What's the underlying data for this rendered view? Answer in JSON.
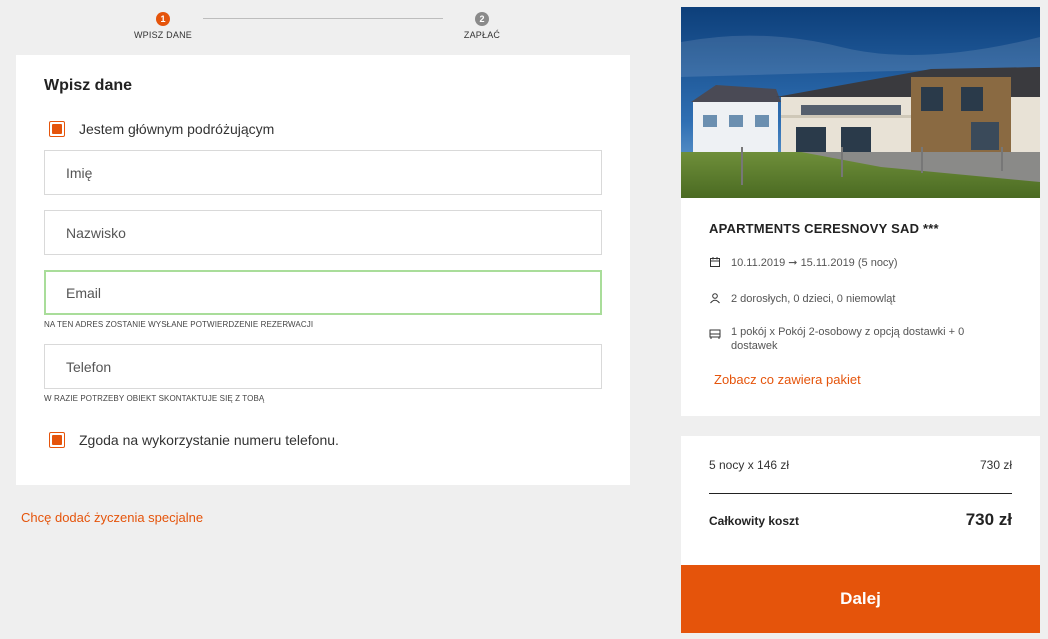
{
  "stepper": {
    "steps": [
      {
        "num": "1",
        "label": "WPISZ DANE",
        "color": "#e5540b"
      },
      {
        "num": "2",
        "label": "ZAPŁAĆ",
        "color": "#8a8a8a"
      }
    ]
  },
  "form": {
    "title": "Wpisz dane",
    "main_traveler_label": "Jestem głównym podróżującym",
    "main_traveler_checked": true,
    "first_name": {
      "placeholder": "Imię",
      "value": ""
    },
    "last_name": {
      "placeholder": "Nazwisko",
      "value": ""
    },
    "email": {
      "placeholder": "Email",
      "value": "",
      "hint": "NA TEN ADRES ZOSTANIE WYSŁANE POTWIERDZENIE REZERWACJI"
    },
    "phone": {
      "placeholder": "Telefon",
      "value": "",
      "hint": "W RAZIE POTRZEBY OBIEKT SKONTAKTUJE SIĘ Z TOBĄ"
    },
    "phone_consent_label": "Zgoda na wykorzystanie numeru telefonu.",
    "phone_consent_checked": true
  },
  "special_requests_link": "Chcę dodać życzenia specjalne",
  "hotel": {
    "name": "APARTMENTS CERESNOVY SAD ***",
    "dates": "10.11.2019 ➞ 15.11.2019 (5 nocy)",
    "guests": "2 dorosłych, 0 dzieci, 0 niemowląt",
    "rooms": "1 pokój x Pokój 2-osobowy z opcją dostawki + 0 dostawek",
    "package_link": "Zobacz co zawiera pakiet",
    "icons": {
      "dates": "calendar-icon",
      "guests": "person-icon",
      "rooms": "bed-icon"
    }
  },
  "price": {
    "nights_label": "5 nocy x 146 zł",
    "nights_value": "730 zł",
    "total_label": "Całkowity koszt",
    "total_value": "730 zł"
  },
  "next_button": "Dalej",
  "colors": {
    "accent": "#e5540b",
    "focus": "#a9dd9a",
    "background": "#efefef"
  }
}
